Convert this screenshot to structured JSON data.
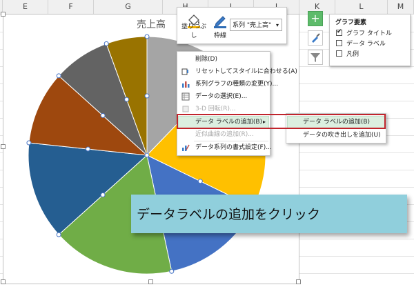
{
  "column_headers": [
    "E",
    "F",
    "G",
    "H",
    "I",
    "J",
    "K",
    "L",
    "M"
  ],
  "chart": {
    "title": "売上高",
    "chart_data": {
      "type": "pie",
      "title": "売上高",
      "slice_colors": [
        "#a5a5a5",
        "#ffc000",
        "#4472c4",
        "#70ad47",
        "#255e91",
        "#9e480e",
        "#636363",
        "#997300"
      ],
      "values": [
        11,
        18,
        13,
        15,
        12,
        9,
        7,
        5
      ]
    }
  },
  "toolbar": {
    "fill_label": "塗りつぶし",
    "outline_label": "枠線",
    "series_select": "系列 \"売上高\""
  },
  "context_menu": {
    "items": [
      {
        "label": "削除(D)",
        "icon": "delete-icon",
        "disabled": false
      },
      {
        "label": "リセットしてスタイルに合わせる(A)",
        "icon": "reset-style-icon",
        "disabled": false
      },
      {
        "label": "系列グラフの種類の変更(Y)...",
        "icon": "chart-type-icon",
        "disabled": false
      },
      {
        "label": "データの選択(E)...",
        "icon": "select-data-icon",
        "disabled": false
      },
      {
        "label": "3-D 回転(R)...",
        "icon": "rotate-3d-icon",
        "disabled": true
      },
      {
        "label": "データ ラベルの追加(B)",
        "icon": "",
        "disabled": false
      },
      {
        "label": "近似曲線の追加(R)...",
        "icon": "",
        "disabled": true
      },
      {
        "label": "データ系列の書式設定(F)...",
        "icon": "format-series-icon",
        "disabled": false
      }
    ],
    "submenu": [
      {
        "label": "データ ラベルの追加(B)"
      },
      {
        "label": "データの吹き出しを追加(U)"
      }
    ]
  },
  "chart_elements": {
    "title": "グラフ要素",
    "items": [
      {
        "label": "グラフ タイトル",
        "checked": true
      },
      {
        "label": "データ ラベル",
        "checked": false
      },
      {
        "label": "凡例",
        "checked": false
      }
    ]
  },
  "callout": {
    "text": "データラベルの追加をクリック"
  },
  "colors": {
    "accent_green": "#5dbb6a",
    "highlight_border": "#c0242c",
    "callout_bg": "#90cfdc"
  }
}
